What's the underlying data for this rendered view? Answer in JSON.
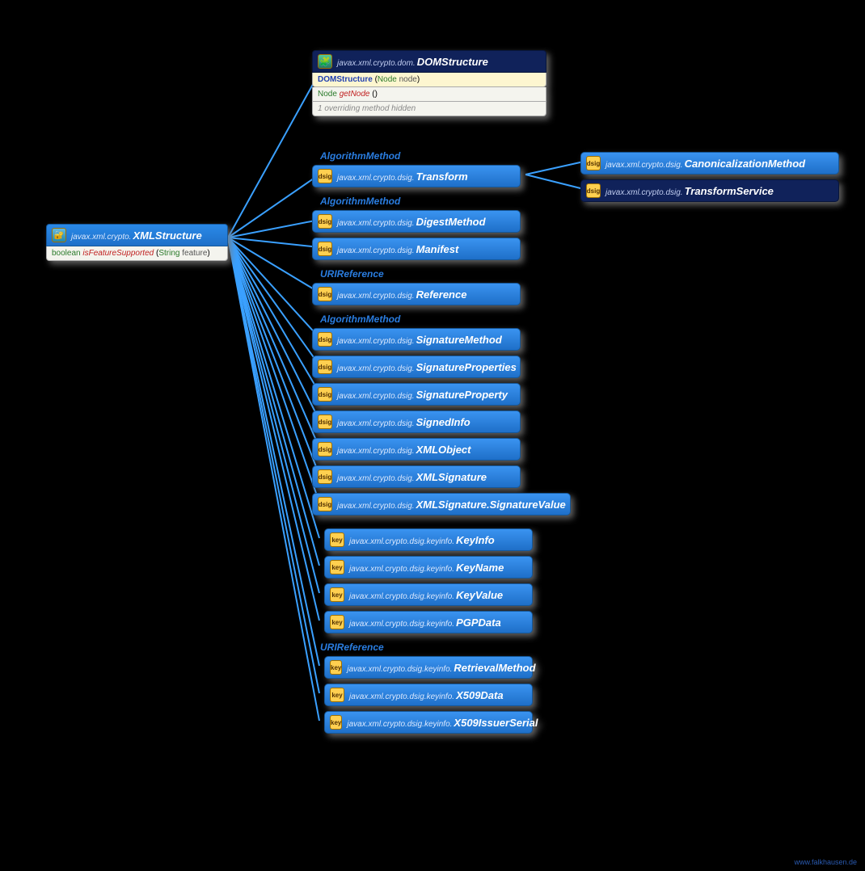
{
  "watermark": "www.falkhausen.de",
  "root": {
    "pkg": "javax.xml.crypto.",
    "name": "XMLStructure",
    "method_ret": "boolean",
    "method_name": "isFeatureSupported",
    "method_arg_t": "String",
    "method_arg_n": "feature"
  },
  "dom": {
    "pkg": "javax.xml.crypto.dom.",
    "name": "DOMStructure",
    "ctor": "DOMStructure",
    "ctor_arg_t": "Node",
    "ctor_arg_n": "node",
    "m_ret": "Node",
    "m_name": "getNode",
    "m_par": "()",
    "hidden": "1 overriding method hidden",
    "hidden_prefix": "1 overriding",
    "hidden_suffix": "method hidden"
  },
  "groups": {
    "am1": "AlgorithmMethod",
    "am2": "AlgorithmMethod",
    "ur1": "URIReference",
    "am3": "AlgorithmMethod",
    "ur2": "URIReference"
  },
  "dsig_pkg": "javax.xml.crypto.dsig.",
  "key_pkg": "javax.xml.crypto.dsig.keyinfo.",
  "mid": [
    {
      "name": "Transform"
    },
    {
      "name": "DigestMethod"
    },
    {
      "name": "Manifest"
    },
    {
      "name": "Reference"
    },
    {
      "name": "SignatureMethod"
    },
    {
      "name": "SignatureProperties"
    },
    {
      "name": "SignatureProperty"
    },
    {
      "name": "SignedInfo"
    },
    {
      "name": "XMLObject"
    },
    {
      "name": "XMLSignature"
    },
    {
      "name": "XMLSignature.SignatureValue"
    },
    {
      "name": "KeyInfo"
    },
    {
      "name": "KeyName"
    },
    {
      "name": "KeyValue"
    },
    {
      "name": "PGPData"
    },
    {
      "name": "RetrievalMethod"
    },
    {
      "name": "X509Data"
    },
    {
      "name": "X509IssuerSerial"
    }
  ],
  "right": {
    "canon": "CanonicalizationMethod",
    "tservice": "TransformService"
  }
}
